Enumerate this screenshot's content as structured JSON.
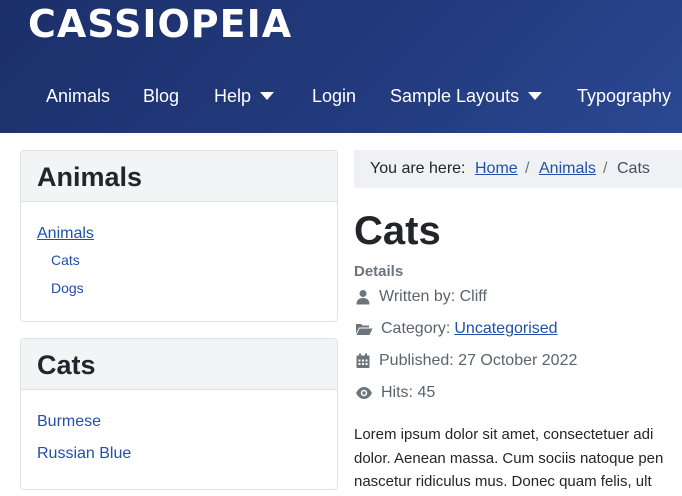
{
  "site": {
    "brand": "CASSIOPEIA"
  },
  "nav": {
    "items": [
      {
        "label": "Animals"
      },
      {
        "label": "Blog"
      },
      {
        "label": "Help"
      },
      {
        "label": "Login"
      },
      {
        "label": "Sample Layouts"
      },
      {
        "label": "Typography"
      }
    ]
  },
  "sidebar": {
    "animals_module": {
      "title": "Animals",
      "parent_link": "Animals",
      "children": [
        "Cats",
        "Dogs"
      ]
    },
    "cats_module": {
      "title": "Cats",
      "links": [
        "Burmese",
        "Russian Blue"
      ]
    }
  },
  "breadcrumb": {
    "prefix": "You are here:",
    "items": [
      "Home",
      "Animals",
      "Cats"
    ],
    "separator": "/"
  },
  "article": {
    "title": "Cats",
    "details_label": "Details",
    "written_by": "Written by: Cliff",
    "category_prefix": "Category:",
    "category": "Uncategorised",
    "published": "Published: 27 October 2022",
    "hits": "Hits: 45",
    "body_lines": [
      "Lorem ipsum dolor sit amet, consectetuer adi",
      "dolor. Aenean massa. Cum sociis natoque pen",
      "nascetur ridiculus mus. Donec quam felis, ult"
    ]
  },
  "colors": {
    "header": "#1f3473",
    "link": "#224faa",
    "card_head": "#f2f4f6",
    "breadcrumb_bg": "#eff1f4"
  }
}
